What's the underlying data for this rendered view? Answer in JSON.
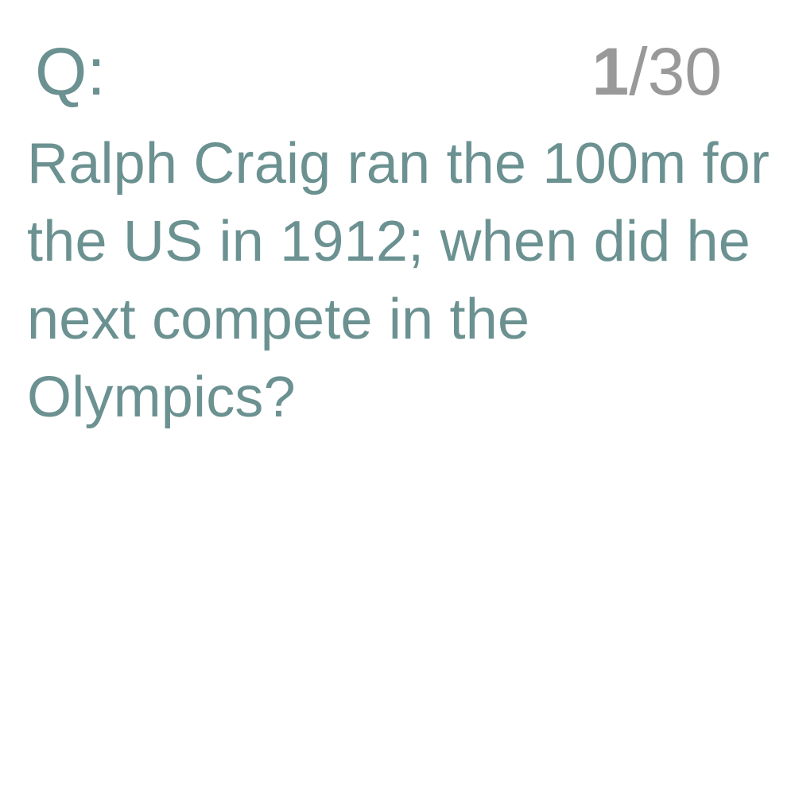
{
  "header": {
    "q_label": "Q:",
    "counter_current": "1",
    "counter_separator": "/",
    "counter_total": "30"
  },
  "question": {
    "text": "Ralph Craig ran the 100m for the US in 1912; when did he next compete in the Olympics?"
  },
  "colors": {
    "accent_text": "#6b9191",
    "counter_text": "#999999",
    "background": "#ffffff"
  }
}
